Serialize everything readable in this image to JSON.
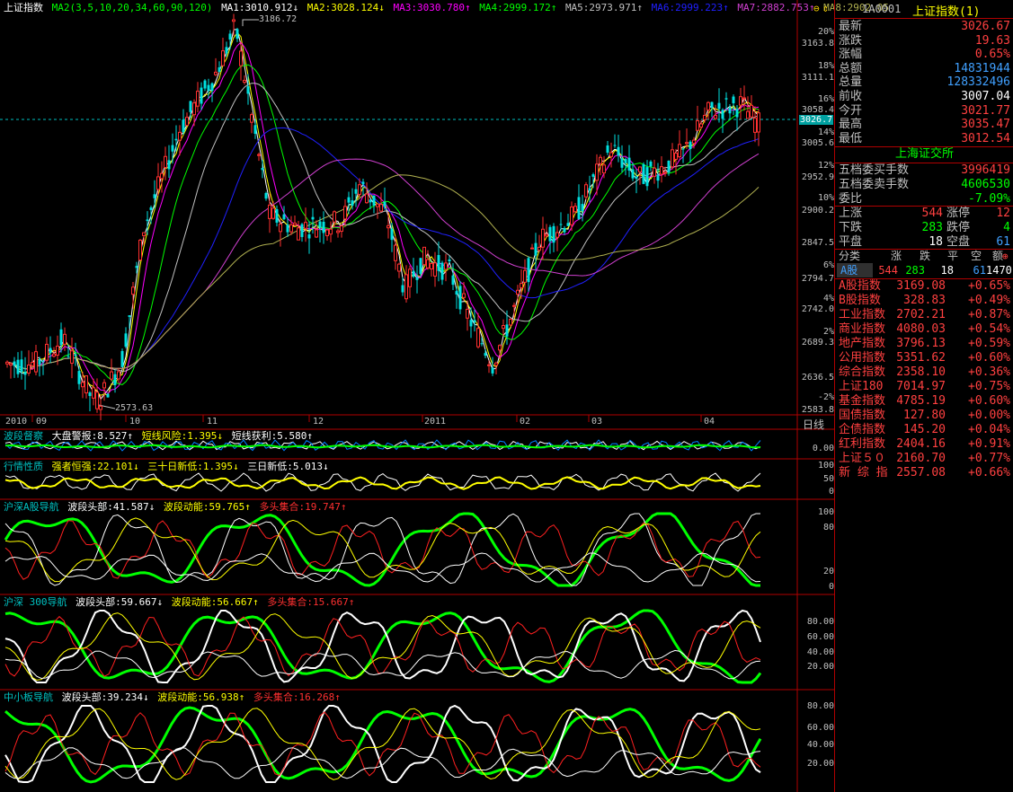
{
  "header": {
    "name": "上证指数",
    "ma_params": "MA2(3,5,10,20,34,60,90,120)",
    "ma": [
      {
        "label": "MA1:3010.912↓",
        "color": "#ffffff"
      },
      {
        "label": "MA2:3028.124↓",
        "color": "#ffff00"
      },
      {
        "label": "MA3:3030.780↑",
        "color": "#ff00ff"
      },
      {
        "label": "MA4:2999.172↑",
        "color": "#00ff00"
      },
      {
        "label": "MA5:2973.971↑",
        "color": "#c0c0c0"
      },
      {
        "label": "MA6:2999.223↑",
        "color": "#2020ff"
      },
      {
        "label": "MA7:2882.753↑",
        "color": "#d040d0"
      },
      {
        "label": "MA8:2902.05",
        "color": "#b0b050"
      }
    ]
  },
  "price_axis": {
    "prices": [
      "3163.8",
      "3111.1",
      "3058.4",
      "3005.6",
      "2952.9",
      "2900.2",
      "2847.5",
      "2794.7",
      "2742.0",
      "2689.3",
      "2636.5",
      "2583.8"
    ],
    "percents": [
      "20%",
      "18%",
      "16%",
      "14%",
      "12%",
      "10%",
      "6%",
      "4%",
      "2%",
      "-2%"
    ],
    "current": "3026.7"
  },
  "annotations": {
    "high": "3186.72",
    "low": "2573.63"
  },
  "date_axis": {
    "labels": [
      "2010",
      "09",
      "10",
      "11",
      "12",
      "2011",
      "02",
      "03",
      "04"
    ],
    "period": "日线"
  },
  "chart_data": {
    "type": "candlestick",
    "title": "上证指数",
    "last": 3026.67,
    "prev_close": 3007.04,
    "high_mark": 3186.72,
    "low_mark": 2573.63,
    "y_range": [
      2560,
      3200
    ]
  },
  "indicators": [
    {
      "name": "波段督察",
      "items": [
        {
          "t": "大盘警报:8.527↑",
          "c": "#ffffff"
        },
        {
          "t": "短线风险:1.395↓",
          "c": "#ffff00"
        },
        {
          "t": "短线获利:5.580↑",
          "c": "#ffffff"
        }
      ],
      "axis": [
        "0.00"
      ]
    },
    {
      "name": "行情性质",
      "items": [
        {
          "t": "强者恒强:22.101↓",
          "c": "#ffff00"
        },
        {
          "t": "三十日新低:1.395↓",
          "c": "#ffff00"
        },
        {
          "t": "三日新低:5.013↓",
          "c": "#ffffff"
        }
      ],
      "axis": [
        "100",
        "50",
        "0"
      ]
    },
    {
      "name": "沪深A股导航",
      "items": [
        {
          "t": "波段头部:41.587↓",
          "c": "#ffffff"
        },
        {
          "t": "波段动能:59.765↑",
          "c": "#ffff00"
        },
        {
          "t": "多头集合:19.747↑",
          "c": "#ff3030"
        }
      ],
      "axis": [
        "100",
        "80",
        "20",
        "0"
      ]
    },
    {
      "name": "沪深 300导航",
      "items": [
        {
          "t": "波段头部:59.667↓",
          "c": "#ffffff"
        },
        {
          "t": "波段动能:56.667↑",
          "c": "#ffff00"
        },
        {
          "t": "多头集合:15.667↑",
          "c": "#ff3030"
        }
      ],
      "axis": [
        "80.00",
        "60.00",
        "40.00",
        "20.00"
      ]
    },
    {
      "name": "中小板导航",
      "items": [
        {
          "t": "波段头部:39.234↓",
          "c": "#ffffff"
        },
        {
          "t": "波段动能:56.938↑",
          "c": "#ffff00"
        },
        {
          "t": "多头集合:16.268↑",
          "c": "#ff3030"
        }
      ],
      "axis": [
        "80.00",
        "60.00",
        "40.00",
        "20.00"
      ]
    }
  ],
  "quote": {
    "code": "1A0001",
    "title": "上证指数(1)",
    "rows": [
      {
        "label": "最新",
        "value": "3026.67",
        "color": "#ff4040"
      },
      {
        "label": "涨跌",
        "value": "19.63",
        "color": "#ff4040"
      },
      {
        "label": "涨幅",
        "value": "0.65%",
        "color": "#ff4040"
      },
      {
        "label": "总额",
        "value": "14831944",
        "color": "#40a0ff"
      },
      {
        "label": "总量",
        "value": "128332496",
        "color": "#40a0ff"
      },
      {
        "label": "前收",
        "value": "3007.04",
        "color": "#ffffff"
      },
      {
        "label": "今开",
        "value": "3021.77",
        "color": "#ff4040"
      },
      {
        "label": "最高",
        "value": "3035.47",
        "color": "#ff4040"
      },
      {
        "label": "最低",
        "value": "3012.54",
        "color": "#ff4040"
      }
    ],
    "exchange": "上海证交所",
    "depth": [
      {
        "label": "五档委买手数",
        "value": "3996419",
        "color": "#ff4040"
      },
      {
        "label": "五档委卖手数",
        "value": "4606530",
        "color": "#00ff00"
      },
      {
        "label": "委比",
        "value": "-7.09%",
        "color": "#00ff00"
      }
    ],
    "breadth": [
      {
        "l1": "上涨",
        "v1": "544",
        "c1": "#ff4040",
        "l2": "涨停",
        "v2": "12",
        "c2": "#ff4040"
      },
      {
        "l1": "下跌",
        "v1": "283",
        "c1": "#00ff00",
        "l2": "跌停",
        "v2": "4",
        "c2": "#00ff00"
      },
      {
        "l1": "平盘",
        "v1": "18",
        "c1": "#ffffff",
        "l2": "空盘",
        "v2": "61",
        "c2": "#40a0ff"
      }
    ],
    "class_header": [
      "分类",
      "涨",
      "跌",
      "平",
      "空",
      "额"
    ],
    "class_row": {
      "name": "A股",
      "up": "544",
      "down": "283",
      "flat": "18",
      "empty": "61",
      "amount": "1470"
    },
    "indices": [
      {
        "name": "A股指数",
        "price": "3169.08",
        "chg": "+0.65%"
      },
      {
        "name": "B股指数",
        "price": "328.83",
        "chg": "+0.49%"
      },
      {
        "name": "工业指数",
        "price": "2702.21",
        "chg": "+0.87%"
      },
      {
        "name": "商业指数",
        "price": "4080.03",
        "chg": "+0.54%"
      },
      {
        "name": "地产指数",
        "price": "3796.13",
        "chg": "+0.59%"
      },
      {
        "name": "公用指数",
        "price": "5351.62",
        "chg": "+0.60%"
      },
      {
        "name": "综合指数",
        "price": "2358.10",
        "chg": "+0.36%"
      },
      {
        "name": "上证180",
        "price": "7014.97",
        "chg": "+0.75%"
      },
      {
        "name": "基金指数",
        "price": "4785.19",
        "chg": "+0.60%"
      },
      {
        "name": "国债指数",
        "price": "127.80",
        "chg": "+0.00%"
      },
      {
        "name": "企债指数",
        "price": "145.20",
        "chg": "+0.04%"
      },
      {
        "name": "红利指数",
        "price": "2404.16",
        "chg": "+0.91%"
      },
      {
        "name": "上证５０",
        "price": "2160.70",
        "chg": "+0.77%"
      },
      {
        "name": "新 综 指",
        "price": "2557.08",
        "chg": "+0.66%"
      }
    ]
  }
}
